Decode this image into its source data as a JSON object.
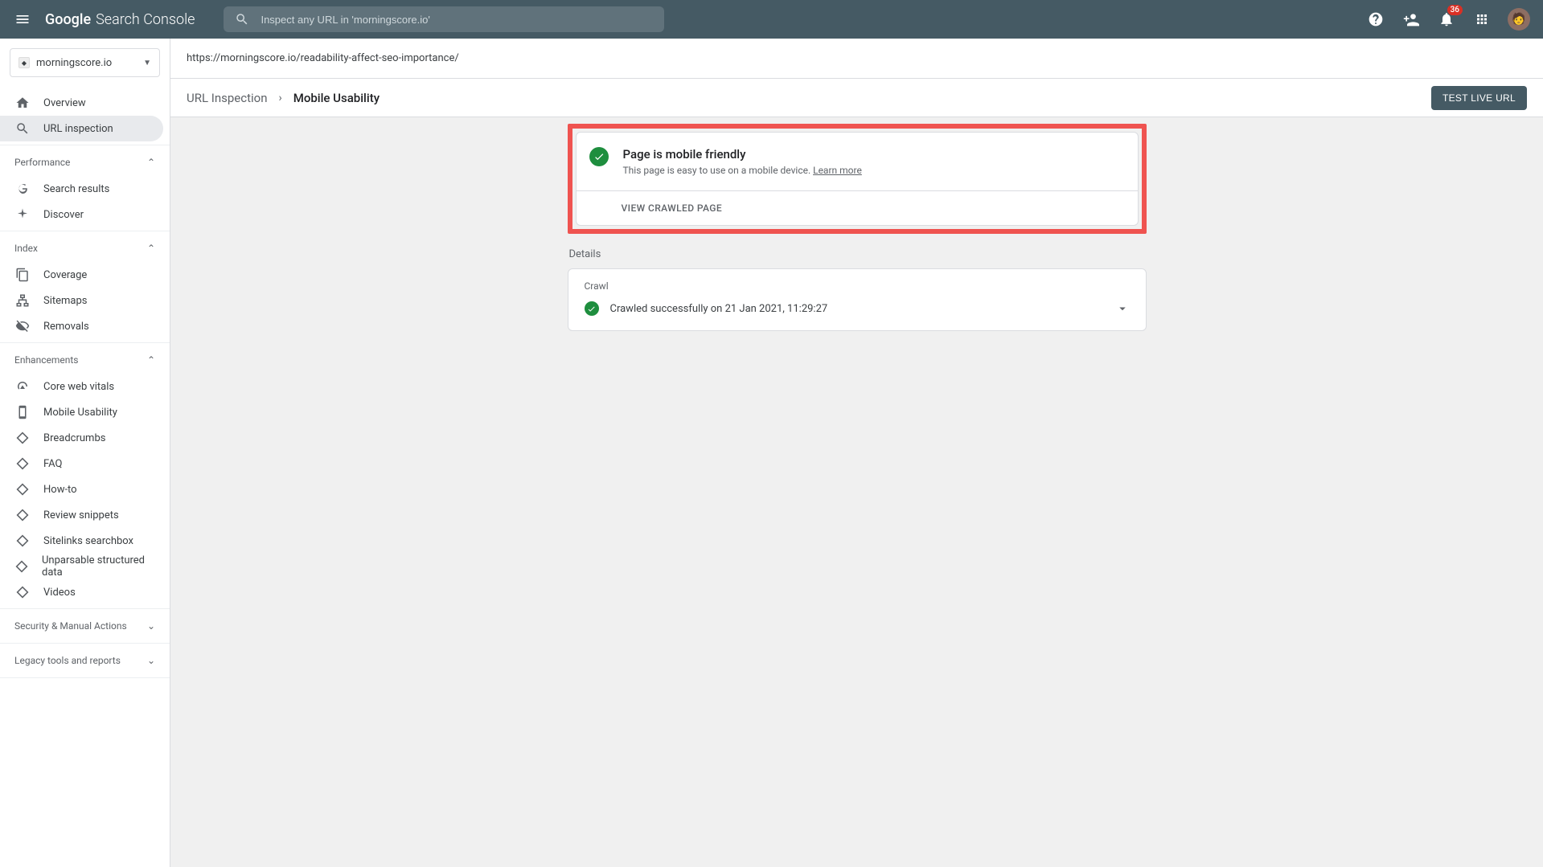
{
  "header": {
    "logo_main": "Google",
    "logo_sub": "Search Console",
    "search_placeholder": "Inspect any URL in 'morningscore.io'",
    "notification_count": "36"
  },
  "property": {
    "name": "morningscore.io"
  },
  "nav": {
    "overview": "Overview",
    "url_inspection": "URL inspection",
    "performance_header": "Performance",
    "search_results": "Search results",
    "discover": "Discover",
    "index_header": "Index",
    "coverage": "Coverage",
    "sitemaps": "Sitemaps",
    "removals": "Removals",
    "enhancements_header": "Enhancements",
    "core_web_vitals": "Core web vitals",
    "mobile_usability": "Mobile Usability",
    "breadcrumbs": "Breadcrumbs",
    "faq": "FAQ",
    "howto": "How-to",
    "review_snippets": "Review snippets",
    "sitelinks_searchbox": "Sitelinks searchbox",
    "unparseable": "Unparsable structured data",
    "videos": "Videos",
    "security_header": "Security & Manual Actions",
    "legacy_header": "Legacy tools and reports"
  },
  "main": {
    "url": "https://morningscore.io/readability-affect-seo-importance/",
    "breadcrumb1": "URL Inspection",
    "breadcrumb2": "Mobile Usability",
    "test_button": "TEST LIVE URL",
    "status_title": "Page is mobile friendly",
    "status_desc": "This page is easy to use on a mobile device. ",
    "learn_more": "Learn more",
    "view_crawled": "VIEW CRAWLED PAGE",
    "details_label": "Details",
    "crawl_label": "Crawl",
    "crawl_status": "Crawled successfully on 21 Jan 2021, 11:29:27"
  }
}
